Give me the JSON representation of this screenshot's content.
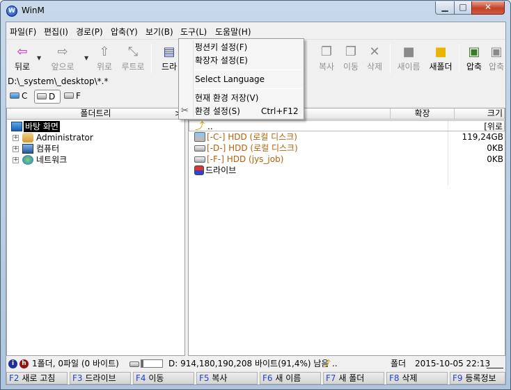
{
  "window": {
    "title": "WinM",
    "app_icon": "W"
  },
  "menubar": [
    "파일(F)",
    "편집(I)",
    "경로(P)",
    "압축(Y)",
    "보기(B)",
    "도구(L)",
    "도움말(H)"
  ],
  "toolbar": {
    "back": "뒤로",
    "forward": "앞으로",
    "up": "위로",
    "root": "루트로",
    "drive": "드라",
    "copy": "복사",
    "move": "이동",
    "delete": "삭제",
    "rename": "새이름",
    "new_folder": "새폴더",
    "compress": "압축",
    "extract": "압축"
  },
  "path": "D:\\_system\\_desktop\\*.*",
  "drives": [
    {
      "letter": "C",
      "selected": false
    },
    {
      "letter": "D",
      "selected": true
    },
    {
      "letter": "F",
      "selected": false
    }
  ],
  "tree": {
    "header": "폴더트리",
    "header_arrow": ">",
    "items": [
      {
        "label": "바탕 화면",
        "selected": true
      },
      {
        "label": "Administrator"
      },
      {
        "label": "컴퓨터"
      },
      {
        "label": "네트워크"
      }
    ]
  },
  "files": {
    "columns": {
      "ext": "확장",
      "size": "크기"
    },
    "rows": [
      {
        "name": "..",
        "size": "[위로",
        "color": "#000000"
      },
      {
        "name": "[-C-] HDD (로컬 디스크)",
        "size": "119,24GB",
        "color": "#b45f06"
      },
      {
        "name": "[-D-] HDD (로컬 디스크)",
        "size": "0KB",
        "color": "#b45f06"
      },
      {
        "name": "[-F-] HDD (jys_job)",
        "size": "0KB",
        "color": "#b45f06"
      },
      {
        "name": "드라이브",
        "size": "",
        "color": "#000000"
      }
    ]
  },
  "status": {
    "counts": "1폴더, 0파일 (0 바이트)",
    "disk": "D: 914,180,190,208 바이트(91,4%) 남음",
    "disk_used_fraction": 0.086,
    "up_label": "..",
    "type": "폴더",
    "datetime": "2015-10-05 22:13",
    "attr": "____"
  },
  "fkeys": [
    {
      "key": "F2",
      "label": "새로 고침"
    },
    {
      "key": "F3",
      "label": "드라이브"
    },
    {
      "key": "F4",
      "label": "이동"
    },
    {
      "key": "F5",
      "label": "복사"
    },
    {
      "key": "F6",
      "label": "새 이름"
    },
    {
      "key": "F7",
      "label": "새 폴더"
    },
    {
      "key": "F8",
      "label": "삭제"
    },
    {
      "key": "F9",
      "label": "등록정보"
    }
  ],
  "tools_menu": {
    "items": [
      {
        "label": "펑션키 설정(F)",
        "shortcut": ""
      },
      {
        "label": "확장자 설정(E)",
        "shortcut": ""
      },
      {
        "label": "Select Language",
        "shortcut": ""
      },
      {
        "label": "현재 환경 저장(V)",
        "shortcut": ""
      },
      {
        "label": "환경 설정(S)",
        "shortcut": "Ctrl+F12"
      }
    ]
  }
}
